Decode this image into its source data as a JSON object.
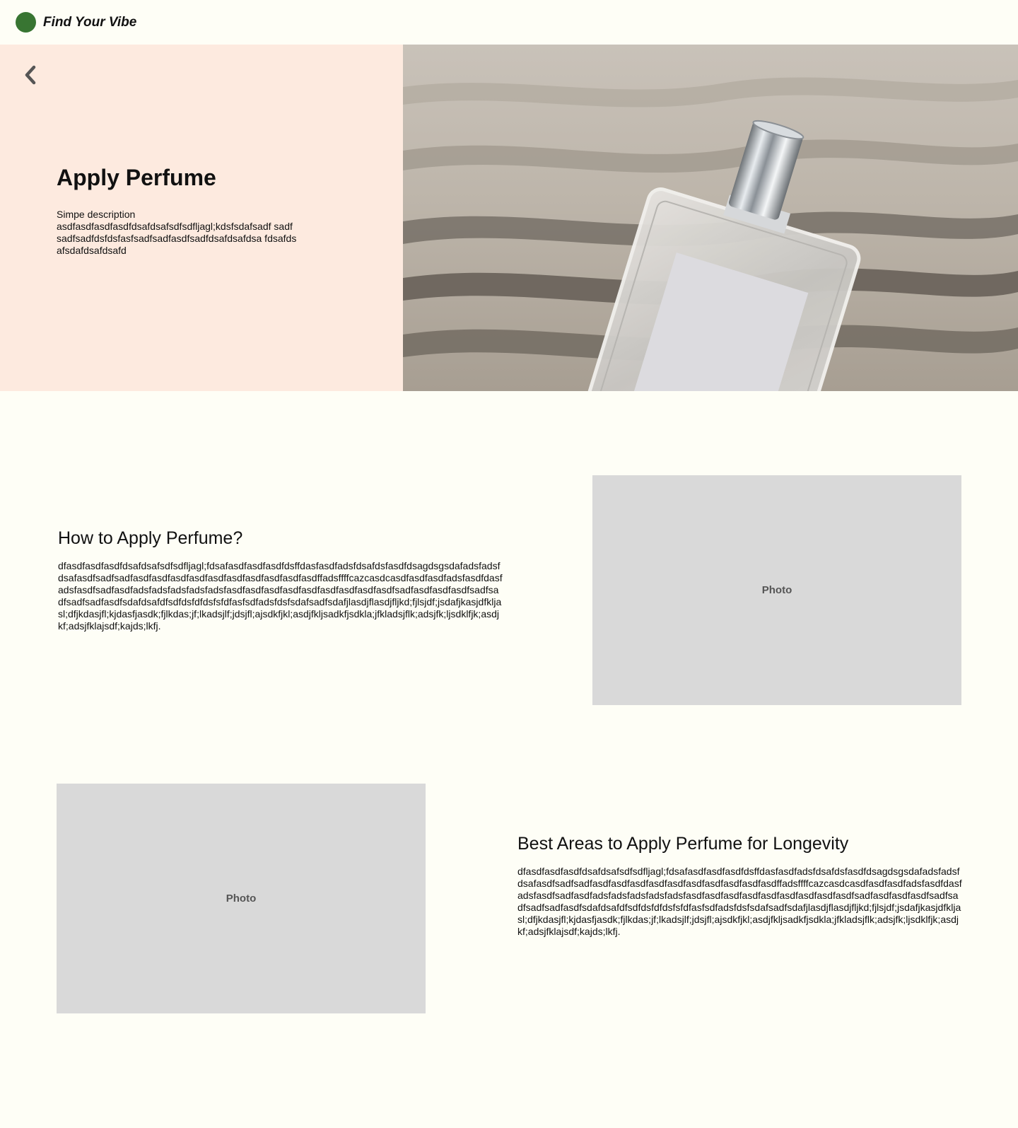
{
  "nav": {
    "brand": "Find Your Vibe"
  },
  "hero": {
    "title": "Apply Perfume",
    "description_label": "Simpe description",
    "description": "asdfasdfasdfasdfdsafdsafsdfsdfljagl;kdsfsdafsadf sadfsadfsadfdsfdsfasfsadfsadfasdfsadfdsafdsafdsa fdsafdsafsdafdsafdsafd"
  },
  "section1": {
    "title": "How to Apply Perfume?",
    "body": "dfasdfasdfasdfdsafdsafsdfsdfljagl;fdsafasdfasdfasdfdsffdasfasdfadsfdsafdsfasdfdsagdsgsdafadsfadsfdsafasdfsadfsadfasdfasdfasdfasdfasdfasdfasdfasdfasdfasdffadsffffcazcasdcasdfasdfasdfadsfasdfdasfadsfasdfsadfasdfadsfadsfadsfadsfadsfasdfasdfasdfasdfasdfasdfasdfasdfasdfsadfasdfasdfasdfsadfsadfsadfsadfasdfsdafdsafdfsdfdsfdfdsfsfdfasfsdfadsfdsfsdafsadfsdafjlasdjflasdjfljkd;fjlsjdf;jsdafjkasjdfkljasl;dfjkdasjfl;kjdasfjasdk;fjlkdas;jf;lkadsjlf;jdsjfl;ajsdkfjkl;asdjfkljsadkfjsdkla;jfkladsjflk;adsjfk;ljsdklfjk;asdjkf;adsjfklajsdf;kajds;lkfj.",
    "photo_label": "Photo"
  },
  "section2": {
    "title": "Best Areas to Apply Perfume for Longevity",
    "body": "dfasdfasdfasdfdsafdsafsdfsdfljagl;fdsafasdfasdfasdfdsffdasfasdfadsfdsafdsfasdfdsagdsgsdafadsfadsfdsafasdfsadfsadfasdfasdfasdfasdfasdfasdfasdfasdfasdfasdffadsffffcazcasdcasdfasdfasdfadsfasdfdasfadsfasdfsadfasdfadsfadsfadsfadsfadsfasdfasdfasdfasdfasdfasdfasdfasdfasdfsadfasdfasdfasdfsadfsadfsadfsadfasdfsdafdsafdfsdfdsfdfdsfsfdfasfsdfadsfdsfsdafsadfsdafjlasdjflasdjfljkd;fjlsjdf;jsdafjkasjdfkljasl;dfjkdasjfl;kjdasfjasdk;fjlkdas;jf;lkadsjlf;jdsjfl;ajsdkfjkl;asdjfkljsadkfjsdkla;jfkladsjflk;adsjfk;ljsdklfjk;asdjkf;adsjfklajsdf;kajds;lkfj.",
    "photo_label": "Photo"
  },
  "icons": {
    "back": "chevron-left-icon",
    "logo": "circle-logo-icon"
  },
  "colors": {
    "background": "#fefef6",
    "hero_panel": "#fdeadf",
    "logo": "#387532",
    "photo_placeholder": "#d9d9d9"
  }
}
